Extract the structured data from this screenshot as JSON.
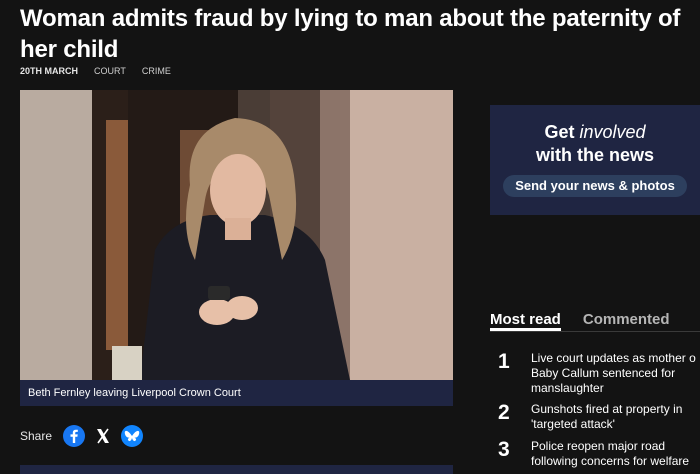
{
  "article": {
    "headline": "Woman admits fraud by lying to man about the paternity of her child",
    "date": "20TH MARCH",
    "tags": [
      "COURT",
      "CRIME"
    ],
    "photo_caption": "Beth Fernley leaving Liverpool Crown Court"
  },
  "share": {
    "label": "Share",
    "icons": [
      "facebook-icon",
      "x-icon",
      "bluesky-icon"
    ],
    "colors": {
      "facebook": "#1877f2",
      "bluesky": "#1185fe"
    }
  },
  "promo": {
    "get": "Get",
    "involved": "involved",
    "line2": "with the news",
    "button": "Send your news & photos"
  },
  "sidebar": {
    "tabs": [
      "Most read",
      "Commented"
    ],
    "most_read": [
      {
        "rank": "1",
        "lines": [
          "Live court updates as mother o",
          "Baby Callum sentenced for",
          "manslaughter"
        ]
      },
      {
        "rank": "2",
        "lines": [
          "Gunshots fired at property in",
          "'targeted attack'"
        ]
      },
      {
        "rank": "3",
        "lines": [
          "Police reopen major road",
          "following concerns for welfare"
        ]
      }
    ]
  },
  "colors": {
    "background": "#131313",
    "navy": "#1f2542",
    "button": "#2d3f5e"
  }
}
